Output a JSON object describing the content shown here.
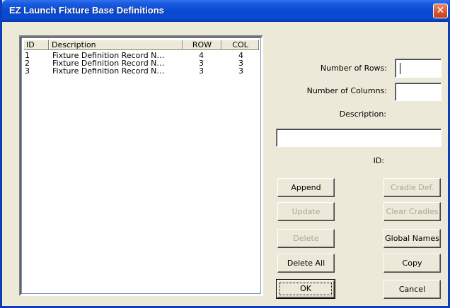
{
  "window": {
    "title": "EZ Launch Fixture Base Definitions",
    "close_glyph": "✕",
    "accent": "#0a48d0"
  },
  "list": {
    "columns": [
      "ID",
      "Description",
      "ROW",
      "COL"
    ],
    "rows": [
      {
        "id": "1",
        "description": "Fixture Definition Record N…",
        "row": "4",
        "col": "4"
      },
      {
        "id": "2",
        "description": "Fixture Definition Record N…",
        "row": "3",
        "col": "3"
      },
      {
        "id": "3",
        "description": "Fixture Definition Record N…",
        "row": "3",
        "col": "3"
      }
    ]
  },
  "form": {
    "rows_label": "Number of Rows:",
    "rows_value": "",
    "columns_label": "Number of Columns:",
    "columns_value": "",
    "description_label": "Description:",
    "description_value": "",
    "id_label": "ID:"
  },
  "buttons": {
    "append": "Append",
    "cradle_def": "Cradle Def.",
    "update": "Update",
    "clear_cradles": "Clear Cradles",
    "delete": "Delete",
    "global_names": "Global Names",
    "delete_all": "Delete All",
    "copy": "Copy",
    "ok": "OK",
    "cancel": "Cancel"
  }
}
